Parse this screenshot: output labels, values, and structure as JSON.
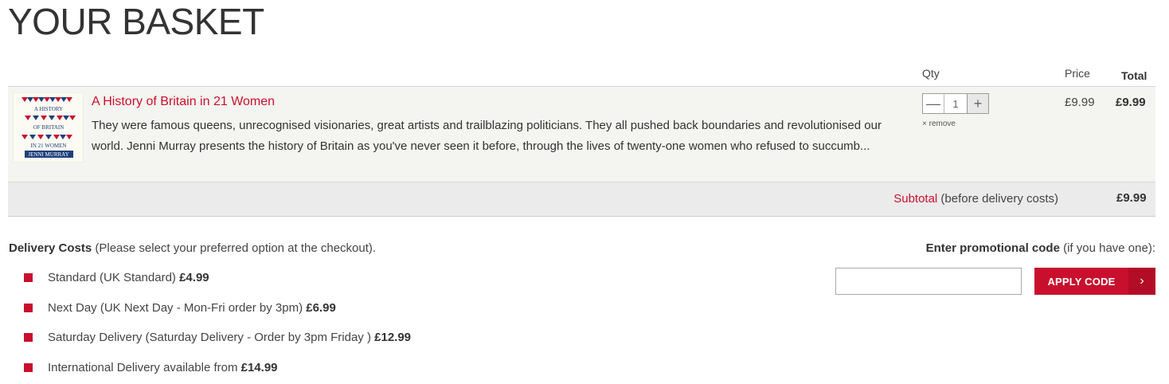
{
  "page": {
    "title": "YOUR BASKET"
  },
  "columns": {
    "qty": "Qty",
    "price": "Price",
    "total": "Total"
  },
  "item": {
    "title": "A History of Britain in 21 Women",
    "description": "They were famous queens, unrecognised visionaries, great artists and trailblazing politicians. They all pushed back boundaries and revolutionised our world. Jenni Murray presents the history of Britain as you've never seen it before, through the lives of twenty-one women who refused to succumb...",
    "quantity": "1",
    "minus": "—",
    "plus": "+",
    "remove": "× remove",
    "price": "£9.99",
    "total": "£9.99",
    "cover_text": {
      "line1": "A HISTORY",
      "line2": "OF BRITAIN",
      "line3": "IN 21 WOMEN",
      "author": "JENNI MURRAY"
    }
  },
  "subtotal": {
    "link": "Subtotal",
    "note": " (before delivery costs)",
    "value": "£9.99"
  },
  "delivery": {
    "heading_bold": "Delivery Costs",
    "heading_rest": " (Please select your preferred option at the checkout).",
    "options": [
      {
        "text": "Standard (UK Standard) ",
        "price": "£4.99"
      },
      {
        "text": "Next Day (UK Next Day - Mon-Fri order by 3pm) ",
        "price": "£6.99"
      },
      {
        "text": "Saturday Delivery (Saturday Delivery - Order by 3pm Friday ) ",
        "price": "£12.99"
      },
      {
        "text": "International Delivery available from ",
        "price": "£14.99"
      }
    ]
  },
  "promo": {
    "label_bold": "Enter promotional code",
    "label_rest": " (if you have one):",
    "value": "",
    "button_label": "APPLY CODE",
    "button_arrow": "›"
  },
  "colors": {
    "accent": "#c8102e",
    "row_bg": "#f4f4f0",
    "subtotal_bg": "#ebebeb"
  }
}
